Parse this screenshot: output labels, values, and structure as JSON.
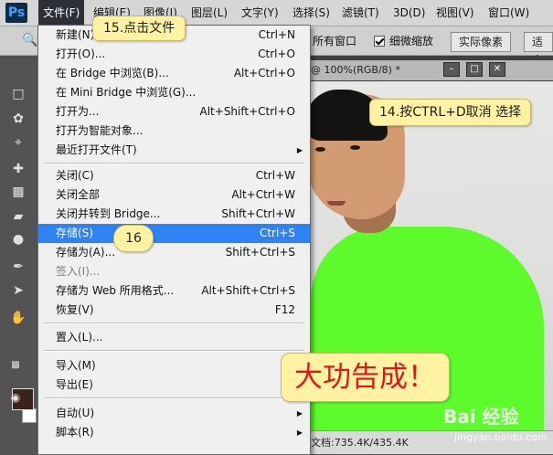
{
  "menubar": {
    "logo": "Ps",
    "items": [
      "文件(F)",
      "编辑(E)",
      "图像(I)",
      "图层(L)",
      "文字(Y)",
      "选择(S)",
      "滤镜(T)",
      "3D(D)",
      "视图(V)",
      "窗口(W)"
    ]
  },
  "options": {
    "all_windows": "所有窗口",
    "scrubby_zoom": "细微缩放",
    "actual_pixels": "实际像素",
    "fit": "适合"
  },
  "document": {
    "tab_title": "@ 100%(RGB/8) *",
    "status": "文档:735.4K/435.4K"
  },
  "file_menu": {
    "items": [
      {
        "label": "新建(N)...",
        "shortcut": "Ctrl+N"
      },
      {
        "label": "打开(O)...",
        "shortcut": "Ctrl+O"
      },
      {
        "label": "在 Bridge 中浏览(B)...",
        "shortcut": "Alt+Ctrl+O"
      },
      {
        "label": "在 Mini Bridge 中浏览(G)...",
        "shortcut": ""
      },
      {
        "label": "打开为...",
        "shortcut": "Alt+Shift+Ctrl+O"
      },
      {
        "label": "打开为智能对象...",
        "shortcut": ""
      },
      {
        "label": "最近打开文件(T)",
        "shortcut": ""
      },
      {
        "label": "关闭(C)",
        "shortcut": "Ctrl+W"
      },
      {
        "label": "关闭全部",
        "shortcut": "Alt+Ctrl+W"
      },
      {
        "label": "关闭并转到 Bridge...",
        "shortcut": "Shift+Ctrl+W"
      },
      {
        "label": "存储(S)",
        "shortcut": "Ctrl+S"
      },
      {
        "label": "存储为(A)...",
        "shortcut": "Shift+Ctrl+S"
      },
      {
        "label": "签入(I)...",
        "shortcut": ""
      },
      {
        "label": "存储为 Web 所用格式...",
        "shortcut": "Alt+Shift+Ctrl+S"
      },
      {
        "label": "恢复(V)",
        "shortcut": "F12"
      },
      {
        "label": "置入(L)...",
        "shortcut": ""
      },
      {
        "label": "导入(M)",
        "shortcut": ""
      },
      {
        "label": "导出(E)",
        "shortcut": ""
      },
      {
        "label": "自动(U)",
        "shortcut": ""
      },
      {
        "label": "脚本(R)",
        "shortcut": ""
      }
    ]
  },
  "annotations": {
    "step15": "15.点击文件",
    "step14": "14.按CTRL+D取消 选择",
    "step16": "16",
    "done": "大功告成！"
  },
  "watermark": {
    "brand": "Bai 经验",
    "url": "jingyan.baidu.com"
  },
  "colors": {
    "highlight": "#2f82f3",
    "note_fill": "#fff3a3",
    "sweater": "#5dfb2b"
  }
}
